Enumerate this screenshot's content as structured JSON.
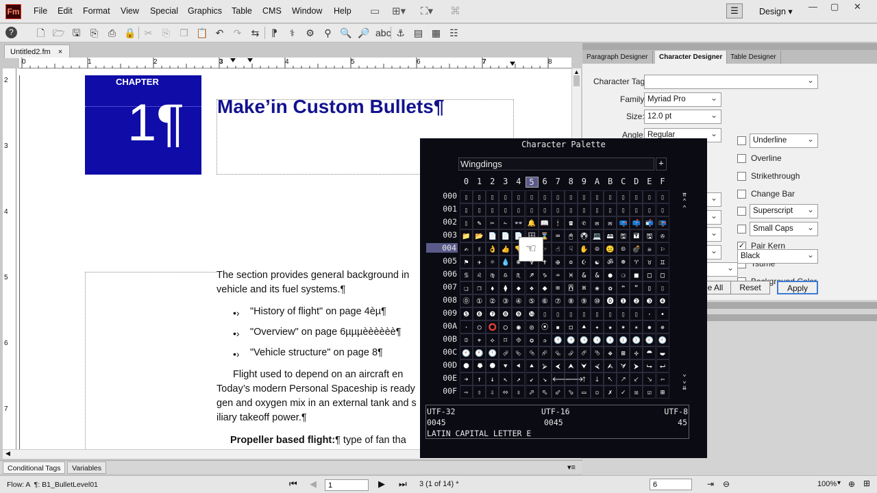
{
  "app": {
    "logo": "Fm",
    "design": "Design"
  },
  "menu": [
    "File",
    "Edit",
    "Format",
    "View",
    "Special",
    "Graphics",
    "Table",
    "CMS",
    "Window",
    "Help"
  ],
  "doc_tab": {
    "label": "Untitled2.fm",
    "close": "×"
  },
  "ruler": {
    "top": [
      "0",
      "1",
      "2",
      "3",
      "4",
      "5",
      "6",
      "7",
      "8"
    ],
    "left": [
      "2",
      "3",
      "4",
      "5",
      "6",
      "7"
    ]
  },
  "document": {
    "chapter_label": "CHAPTER",
    "chapter_number": "1¶",
    "title": "Make’in Custom Bullets¶",
    "para1a": "The section provides general background in",
    "para1b": "vehicle and its fuel systems.¶",
    "bullets": [
      "\"History of flight\" on page 4èµ¶",
      "\"Overview\" on page 6µµµèèèèèè¶",
      "\"Vehicle structure\" on page 8¶"
    ],
    "bullet_symbol": "•›",
    "para2a": "Flight used to depend on an aircraft en",
    "para2b": "Today’s modern Personal Spaceship is ready",
    "para2c": "gen and oxygen mix in an external tank and s",
    "para2d": "iliary takeoff power.¶",
    "para3_bold": "Propeller based flight:",
    "para3_rest": "¶ type of fan tha"
  },
  "bottom_tabs": [
    "Conditional Tags",
    "Variables"
  ],
  "status": {
    "flow": "Flow: A  ¶: B1_BulletLevel01",
    "page_input": "1",
    "page_info": "3 (1 of 14) *",
    "zoom_input": "6",
    "zoom": "100%"
  },
  "right_panel": {
    "tabs": [
      "Paragraph Designer",
      "Character Designer",
      "Table Designer"
    ],
    "character_tag_label": "Character Tag:",
    "character_tag": "",
    "family_label": "Family:",
    "family": "Myriad Pro",
    "size_label": "Size:",
    "size": "12.0 pt",
    "angle_label": "Angle:",
    "angle": "Regular",
    "checkboxes": [
      {
        "label": "Underline",
        "checked": false,
        "dropdown": true
      },
      {
        "label": "Overline",
        "checked": false
      },
      {
        "label": "Strikethrough",
        "checked": false
      },
      {
        "label": "Change Bar",
        "checked": false
      },
      {
        "label": "Superscript",
        "checked": false,
        "dropdown": true
      },
      {
        "label": "Small Caps",
        "checked": false,
        "dropdown": true
      },
      {
        "label": "Pair Kern",
        "checked": true
      },
      {
        "label": "Tsume",
        "checked": false
      },
      {
        "label": "Background Color",
        "checked": false
      }
    ],
    "background_color": "Black",
    "btn_all": "e All",
    "btn_reset": "Reset",
    "btn_apply": "Apply"
  },
  "palette": {
    "title": "Character Palette",
    "font": "Wingdings",
    "add": "+",
    "col_headers": [
      "0",
      "1",
      "2",
      "3",
      "4",
      "5",
      "6",
      "7",
      "8",
      "9",
      "A",
      "B",
      "C",
      "D",
      "E",
      "F"
    ],
    "row_headers": [
      "000",
      "001",
      "002",
      "003",
      "004",
      "005",
      "006",
      "007",
      "008",
      "009",
      "00A",
      "00B",
      "00C",
      "00D",
      "00E",
      "00F"
    ],
    "selected_row": "004",
    "selected_col": "5",
    "glyphs": [
      [
        "",
        "",
        "",
        "",
        "",
        "",
        "",
        "",
        "",
        "",
        "",
        "",
        "",
        "",
        "",
        ""
      ],
      [
        "",
        "",
        "",
        "",
        "",
        "",
        "",
        "",
        "",
        "",
        "",
        "",
        "",
        "",
        "",
        ""
      ],
      [
        "",
        "✎",
        "✂",
        "✁",
        "👓",
        "🔔",
        "📖",
        "🕯",
        "☎",
        "✆",
        "✉",
        "✉",
        "📪",
        "📫",
        "📬",
        "📭"
      ],
      [
        "📁",
        "📂",
        "📄",
        "📄",
        "📄",
        "🗄",
        "⌛",
        "⌨",
        "🖱",
        "🖲",
        "💻",
        "🖴",
        "🖫",
        "🖬",
        "🖫",
        "✇"
      ],
      [
        "✍",
        "✌",
        "👌",
        "👍",
        "👎",
        "☜",
        "☞",
        "☝",
        "☟",
        "✋",
        "☺",
        "😐",
        "☹",
        "💣",
        "☠",
        "⚐"
      ],
      [
        "⚑",
        "✈",
        "☼",
        "💧",
        "❄",
        "✞",
        "✝",
        "✠",
        "✡",
        "☪",
        "☯",
        "ॐ",
        "☸",
        "♈",
        "♉",
        "♊"
      ],
      [
        "♋",
        "♌",
        "♍",
        "♎",
        "♏",
        "♐",
        "♑",
        "♒",
        "♓",
        "&",
        "&",
        "●",
        "❍",
        "■",
        "□",
        "□"
      ],
      [
        "❑",
        "❒",
        "⬧",
        "⧫",
        "◆",
        "❖",
        "⬥",
        "⌧",
        "⍓",
        "⌘",
        "❀",
        "✿",
        "❝",
        "❞",
        "▯",
        ""
      ],
      [
        "⓪",
        "①",
        "②",
        "③",
        "④",
        "⑤",
        "⑥",
        "⑦",
        "⑧",
        "⑨",
        "⑩",
        "⓿",
        "❶",
        "❷",
        "❸",
        "❹"
      ],
      [
        "❺",
        "❻",
        "❼",
        "❽",
        "❾",
        "❿",
        "",
        "",
        "",
        "",
        "",
        "",
        "",
        "",
        "·",
        "•"
      ],
      [
        "·",
        "○",
        "⭕",
        "◯",
        "◉",
        "◎",
        "⦿",
        "▪",
        "◻",
        "⯅",
        "✦",
        "★",
        "✶",
        "✴",
        "✹",
        "✵"
      ],
      [
        "⯐",
        "⌖",
        "⟡",
        "⌑",
        "⯑",
        "✪",
        "✰",
        "🕐",
        "🕑",
        "🕒",
        "🕓",
        "🕔",
        "🕕",
        "🕖",
        "🕗",
        "🕘"
      ],
      [
        "🕙",
        "🕚",
        "🕛",
        "⮰",
        "⮱",
        "⮲",
        "⮳",
        "⮴",
        "⮵",
        "⮶",
        "⮷",
        "✥",
        "⊠",
        "✣",
        "⯊",
        "⯋"
      ],
      [
        "⯃",
        "⯂",
        "⯄",
        "⯆",
        "⯇",
        "⯅",
        "⮚",
        "⮜",
        "⮝",
        "⮟",
        "⮘",
        "⮙",
        "⮛",
        "⮞",
        "⮡",
        "⮠"
      ],
      [
        "➔",
        "↑",
        "↓",
        "↖",
        "↗",
        "↙",
        "↘",
        "🡐",
        "🡒",
        "🡑",
        "🡓",
        "🡔",
        "🡕",
        "🡗",
        "🡖",
        "⇦"
      ],
      [
        "⇨",
        "⇧",
        "⇩",
        "⬄",
        "⇳",
        "⬀",
        "⬁",
        "⬃",
        "⬂",
        "▭",
        "▫",
        "✗",
        "✓",
        "☒",
        "☑",
        "⊞"
      ]
    ],
    "magnified": "☜",
    "info": {
      "utf32_label": "UTF-32",
      "utf16_label": "UTF-16",
      "utf8_label": "UTF-8",
      "utf32": "0045",
      "utf16": "0045",
      "utf8": "45",
      "name": "LATIN CAPITAL LETTER E"
    }
  },
  "colors": {
    "chapter_bg": "#0f0ca8",
    "title": "#12128f",
    "palette_bg": "#0b0b14",
    "selected": "#5a5a8a"
  }
}
